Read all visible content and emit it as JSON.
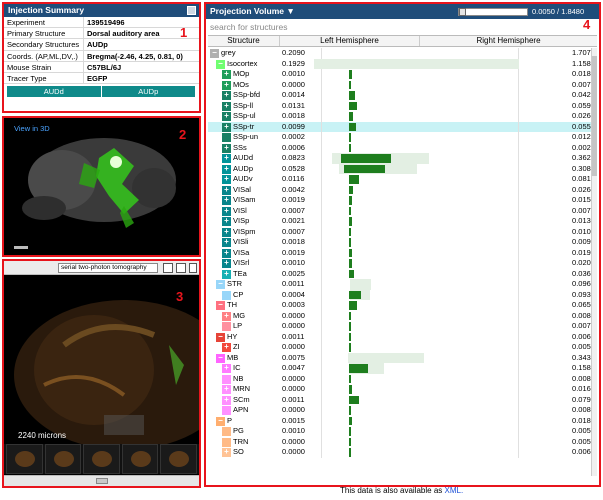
{
  "colors": {
    "red": "#e8141c",
    "header": "#1f4d7a",
    "teal": "#0f8a8a",
    "green": "#1e7e1e"
  },
  "badges": [
    "1",
    "2",
    "3",
    "4"
  ],
  "injection": {
    "title": "Injection Summary",
    "rows": [
      {
        "k": "Experiment",
        "v": "139519496"
      },
      {
        "k": "Primary Structure",
        "v": "Dorsal auditory area"
      },
      {
        "k": "Secondary Structures",
        "v": "AUDp"
      },
      {
        "k": "Coords. (AP,ML,DV,.)",
        "v": "Bregma(-2.46, 4.25, 0.81, 0)"
      },
      {
        "k": "Mouse Strain",
        "v": "C57BL/6J"
      },
      {
        "k": "Tracer Type",
        "v": "EGFP"
      }
    ],
    "buttons": [
      "AUDd",
      "AUDp"
    ]
  },
  "viewer3d": {
    "link": "View in 3D"
  },
  "imageViewer": {
    "mode": "serial two-photon tomography",
    "scale": "2240 microns"
  },
  "projection": {
    "title": "Projection Volume ▼",
    "scale_label": "0.0050 / 1.8480 mm³",
    "search_placeholder": "search for structures",
    "headers": [
      "Structure",
      "Left Hemisphere",
      "Right Hemisphere"
    ],
    "rows": [
      {
        "name": "grey",
        "indent": 0,
        "color": "#b0b0b0",
        "sign": "-",
        "left": 0.209,
        "right": 1.7077
      },
      {
        "name": "Isocortex",
        "indent": 1,
        "color": "#70ff71",
        "sign": "-",
        "left": 0.1929,
        "right": 1.1587
      },
      {
        "name": "MOp",
        "indent": 2,
        "color": "#1f9d5a",
        "sign": "+",
        "left": 0.001,
        "right": 0.0181
      },
      {
        "name": "MOs",
        "indent": 2,
        "color": "#1f9d5a",
        "sign": "+",
        "left": 0.0,
        "right": 0.0076
      },
      {
        "name": "SSp-bfd",
        "indent": 2,
        "color": "#188064",
        "sign": "+",
        "left": 0.0014,
        "right": 0.0424
      },
      {
        "name": "SSp-ll",
        "indent": 2,
        "color": "#188064",
        "sign": "+",
        "left": 0.0131,
        "right": 0.0596
      },
      {
        "name": "SSp-ul",
        "indent": 2,
        "color": "#188064",
        "sign": "+",
        "left": 0.0018,
        "right": 0.0264
      },
      {
        "name": "SSp-tr",
        "indent": 2,
        "color": "#188064",
        "sign": "+",
        "left": 0.0099,
        "right": 0.0553,
        "hl": true
      },
      {
        "name": "SSp-un",
        "indent": 2,
        "color": "#188064",
        "sign": "",
        "left": 0.0002,
        "right": 0.0125
      },
      {
        "name": "SSs",
        "indent": 2,
        "color": "#188064",
        "sign": "+",
        "left": 0.0006,
        "right": 0.0025
      },
      {
        "name": "AUDd",
        "indent": 2,
        "color": "#019399",
        "sign": "+",
        "left": 0.0823,
        "right": 0.3627
      },
      {
        "name": "AUDp",
        "indent": 2,
        "color": "#019399",
        "sign": "+",
        "left": 0.0528,
        "right": 0.3083
      },
      {
        "name": "AUDv",
        "indent": 2,
        "color": "#019399",
        "sign": "+",
        "left": 0.0116,
        "right": 0.0815
      },
      {
        "name": "VISal",
        "indent": 2,
        "color": "#08858c",
        "sign": "+",
        "left": 0.0042,
        "right": 0.026
      },
      {
        "name": "VISam",
        "indent": 2,
        "color": "#08858c",
        "sign": "+",
        "left": 0.0019,
        "right": 0.0159
      },
      {
        "name": "VISl",
        "indent": 2,
        "color": "#08858c",
        "sign": "+",
        "left": 0.0007,
        "right": 0.0077
      },
      {
        "name": "VISp",
        "indent": 2,
        "color": "#08858c",
        "sign": "+",
        "left": 0.0021,
        "right": 0.0134
      },
      {
        "name": "VISpm",
        "indent": 2,
        "color": "#08858c",
        "sign": "+",
        "left": 0.0007,
        "right": 0.0102
      },
      {
        "name": "VISli",
        "indent": 2,
        "color": "#08858c",
        "sign": "+",
        "left": 0.0018,
        "right": 0.0094
      },
      {
        "name": "VISa",
        "indent": 2,
        "color": "#08858c",
        "sign": "+",
        "left": 0.0019,
        "right": 0.0195
      },
      {
        "name": "VISrl",
        "indent": 2,
        "color": "#08858c",
        "sign": "+",
        "left": 0.001,
        "right": 0.0207
      },
      {
        "name": "TEa",
        "indent": 2,
        "color": "#15b0b3",
        "sign": "+",
        "left": 0.0025,
        "right": 0.0365
      },
      {
        "name": "STR",
        "indent": 1,
        "color": "#98d6f9",
        "sign": "-",
        "left": 0.0011,
        "right": 0.0961
      },
      {
        "name": "CP",
        "indent": 2,
        "color": "#98d6f9",
        "sign": "",
        "left": 0.0004,
        "right": 0.0937
      },
      {
        "name": "TH",
        "indent": 1,
        "color": "#ff7080",
        "sign": "-",
        "left": 0.0003,
        "right": 0.0656
      },
      {
        "name": "MG",
        "indent": 2,
        "color": "#ff8084",
        "sign": "+",
        "left": 0.0,
        "right": 0.0087
      },
      {
        "name": "LP",
        "indent": 2,
        "color": "#ff909f",
        "sign": "",
        "left": 0.0,
        "right": 0.0077
      },
      {
        "name": "HY",
        "indent": 1,
        "color": "#e64438",
        "sign": "-",
        "left": 0.0011,
        "right": 0.0068
      },
      {
        "name": "ZI",
        "indent": 2,
        "color": "#f2483b",
        "sign": "+",
        "left": 0.0,
        "right": 0.0053
      },
      {
        "name": "MB",
        "indent": 1,
        "color": "#ff64ff",
        "sign": "-",
        "left": 0.0075,
        "right": 0.3436
      },
      {
        "name": "IC",
        "indent": 2,
        "color": "#ff7aff",
        "sign": "+",
        "left": 0.0047,
        "right": 0.1589
      },
      {
        "name": "NB",
        "indent": 2,
        "color": "#ff90ff",
        "sign": "",
        "left": 0.0,
        "right": 0.0083
      },
      {
        "name": "MRN",
        "indent": 2,
        "color": "#ff90ff",
        "sign": "+",
        "left": 0.0,
        "right": 0.0166
      },
      {
        "name": "SCm",
        "indent": 2,
        "color": "#ff90ff",
        "sign": "+",
        "left": 0.0011,
        "right": 0.0791
      },
      {
        "name": "APN",
        "indent": 2,
        "color": "#ff90ff",
        "sign": "",
        "left": 0.0,
        "right": 0.0084
      },
      {
        "name": "P",
        "indent": 1,
        "color": "#ffae6f",
        "sign": "-",
        "left": 0.0015,
        "right": 0.0185
      },
      {
        "name": "PG",
        "indent": 2,
        "color": "#ffba86",
        "sign": "",
        "left": 0.001,
        "right": 0.0054
      },
      {
        "name": "TRN",
        "indent": 2,
        "color": "#ffba86",
        "sign": "",
        "left": 0.0,
        "right": 0.005
      },
      {
        "name": "SO",
        "indent": 2,
        "color": "#ffc395",
        "sign": "+",
        "left": 0.0,
        "right": 0.0061
      }
    ]
  },
  "footer": {
    "text": "This data is also available as ",
    "link": "XML."
  }
}
